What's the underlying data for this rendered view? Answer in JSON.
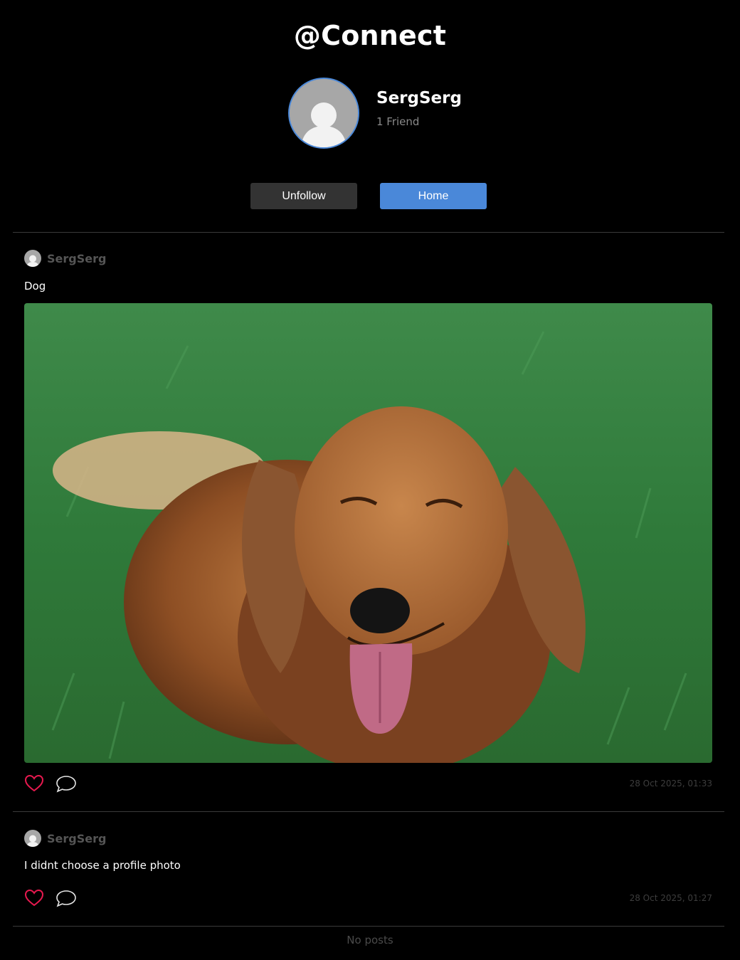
{
  "app": {
    "title": "@Connect"
  },
  "profile": {
    "name": "SergSerg",
    "friends": "1 Friend",
    "avatar_icon": "default-avatar-icon"
  },
  "actions": {
    "unfollow_label": "Unfollow",
    "home_label": "Home"
  },
  "posts": [
    {
      "author": "SergSerg",
      "text": "Dog",
      "image": "long-haired dachshund lying on grass",
      "timestamp": "28 Oct 2025, 01:33",
      "like_icon": "heart-icon",
      "comment_icon": "comment-icon"
    },
    {
      "author": "SergSerg",
      "text": "I didnt choose a profile photo",
      "timestamp": "28 Oct 2025, 01:27",
      "like_icon": "heart-icon",
      "comment_icon": "comment-icon"
    }
  ],
  "feed": {
    "empty_text": "No posts"
  },
  "colors": {
    "accent": "#4a88d9",
    "like": "#e8194f",
    "secondary_button": "#333333",
    "background": "#000000"
  }
}
